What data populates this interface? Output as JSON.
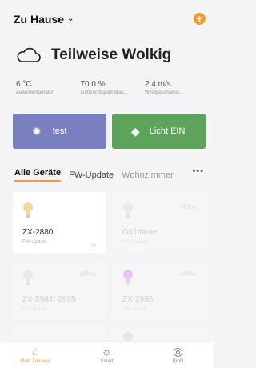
{
  "header": {
    "home_label": "Zu Hause",
    "chevron_glyph": "⌄",
    "add_glyph": "+"
  },
  "weather": {
    "title": "Teilweise Wolkig",
    "stats": [
      {
        "value": "6 °C",
        "label": "Außentemperatur"
      },
      {
        "value": "70.0 %",
        "label": "Luftfeuchtigkeit drau..."
      },
      {
        "value": "2.4 m/s",
        "label": "Windgeschwindi..."
      }
    ]
  },
  "scenes": [
    {
      "label": "test",
      "icon": "light-icon",
      "color": "#7a7fbf"
    },
    {
      "label": "Licht EIN",
      "icon": "tag-icon",
      "color": "#5ea35a"
    }
  ],
  "tabs": [
    {
      "label": "Alle Geräte"
    },
    {
      "label": "FW-Update"
    },
    {
      "label": "Wohnzimmer"
    }
  ],
  "tabs_more": "•••",
  "devices": [
    {
      "name": "ZX-2880",
      "sub": "FW-Update",
      "offline_label": "",
      "bulb_color": "#f2d9a0"
    },
    {
      "name": "Glühbirne",
      "sub": "FW-Update",
      "offline_label": "offline",
      "bulb_color": "#e9e9e9"
    },
    {
      "name": "ZX-2984/-2985",
      "sub": "FW-Update",
      "offline_label": "offline",
      "bulb_color": "#e9e9e9"
    },
    {
      "name": "ZX-2986",
      "sub": "FW-Update",
      "offline_label": "offline",
      "bulb_color": "#e8c4ef"
    }
  ],
  "nav": [
    {
      "label": "Mein Zuhause",
      "icon": "home-icon"
    },
    {
      "label": "Smart",
      "icon": "sun-icon"
    },
    {
      "label": "Profil",
      "icon": "user-icon"
    }
  ],
  "colors": {
    "accent": "#f29c33"
  }
}
